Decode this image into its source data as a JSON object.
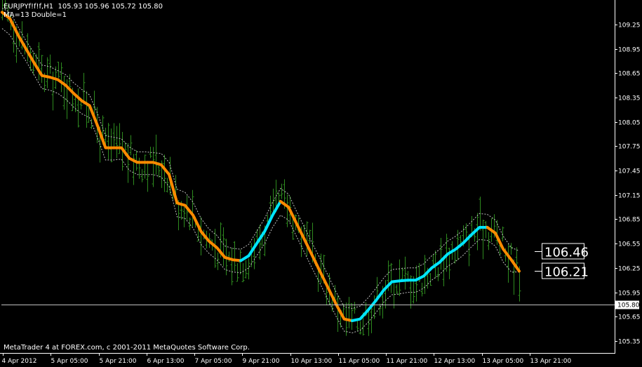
{
  "header": {
    "title": "EURJPYf!f!f,H1  105.93 105.96 105.72 105.80",
    "indicator": "MA=13 Double=1"
  },
  "footer": {
    "text": "MetaTrader 4 at FOREX.com, c 2001-2011 MetaQuotes Software Corp."
  },
  "colors": {
    "background": "#000000",
    "candles": "#2e8b1f",
    "ma_down": "#ff8a00",
    "ma_up": "#00e5ff",
    "envelope": "#bfbfbf",
    "axis": "#ffffff"
  },
  "chart_data": {
    "type": "line",
    "title": "EURJPYf!f!f,H1",
    "y_ticks": [
      109.25,
      108.95,
      108.65,
      108.35,
      108.05,
      107.75,
      107.45,
      107.15,
      106.85,
      106.55,
      106.25,
      105.95,
      105.65,
      105.35
    ],
    "ylim": [
      105.28,
      109.43
    ],
    "x_ticks": [
      "4 Apr 2012",
      "5 Apr 05:00",
      "5 Apr 21:00",
      "6 Apr 13:00",
      "7 Apr 05:00",
      "9 Apr 21:00",
      "10 Apr 13:00",
      "11 Apr 05:00",
      "11 Apr 21:00",
      "12 Apr 13:00",
      "13 Apr 05:00",
      "13 Apr 21:00"
    ],
    "current_price": {
      "label": "105.80",
      "value": 105.8
    },
    "level_labels": [
      {
        "text": "106.46",
        "value": 106.46
      },
      {
        "text": "106.21",
        "value": 106.21
      }
    ],
    "bar_count": 186,
    "ma_series": {
      "name": "MA=13",
      "values": [
        109.4,
        109.32,
        109.12,
        108.95,
        108.78,
        108.62,
        108.6,
        108.57,
        108.5,
        108.4,
        108.31,
        108.25,
        108.0,
        107.73,
        107.73,
        107.73,
        107.6,
        107.55,
        107.55,
        107.55,
        107.52,
        107.4,
        107.05,
        107.02,
        106.9,
        106.7,
        106.58,
        106.5,
        106.38,
        106.35,
        106.34,
        106.4,
        106.55,
        106.7,
        106.9,
        107.07,
        107.0,
        106.8,
        106.6,
        106.4,
        106.2,
        106.0,
        105.8,
        105.62,
        105.6,
        105.62,
        105.73,
        105.85,
        105.98,
        106.08,
        106.09,
        106.1,
        106.1,
        106.15,
        106.25,
        106.32,
        106.42,
        106.48,
        106.56,
        106.66,
        106.75,
        106.75,
        106.68,
        106.48,
        106.35,
        106.21
      ],
      "segments": [
        {
          "direction": "down",
          "from": 0,
          "to": 30
        },
        {
          "direction": "up",
          "from": 30,
          "to": 35
        },
        {
          "direction": "down",
          "from": 35,
          "to": 44
        },
        {
          "direction": "up",
          "from": 44,
          "to": 61
        },
        {
          "direction": "down",
          "from": 61,
          "to": 65
        }
      ]
    },
    "envelope_series": {
      "name": "Double=1",
      "upper": [
        109.45,
        109.4,
        109.22,
        109.05,
        108.9,
        108.75,
        108.73,
        108.68,
        108.63,
        108.53,
        108.45,
        108.38,
        108.15,
        107.88,
        107.86,
        107.84,
        107.74,
        107.68,
        107.68,
        107.67,
        107.66,
        107.55,
        107.22,
        107.18,
        107.06,
        106.86,
        106.73,
        106.65,
        106.52,
        106.49,
        106.48,
        106.54,
        106.7,
        106.86,
        107.06,
        107.23,
        107.16,
        106.95,
        106.75,
        106.55,
        106.36,
        106.15,
        105.95,
        105.77,
        105.75,
        105.78,
        105.88,
        106.0,
        106.13,
        106.23,
        106.24,
        106.25,
        106.25,
        106.3,
        106.4,
        106.48,
        106.58,
        106.64,
        106.72,
        106.82,
        106.92,
        106.91,
        106.84,
        106.64,
        106.5,
        106.46
      ],
      "lower": [
        109.2,
        109.12,
        108.95,
        108.8,
        108.63,
        108.46,
        108.44,
        108.4,
        108.33,
        108.23,
        108.15,
        108.1,
        107.85,
        107.58,
        107.58,
        107.59,
        107.45,
        107.4,
        107.4,
        107.4,
        107.37,
        107.25,
        106.88,
        106.86,
        106.74,
        106.54,
        106.43,
        106.35,
        106.23,
        106.2,
        106.19,
        106.25,
        106.4,
        106.55,
        106.75,
        106.9,
        106.84,
        106.64,
        106.44,
        106.24,
        106.05,
        105.85,
        105.65,
        105.47,
        105.45,
        105.48,
        105.58,
        105.7,
        105.83,
        105.92,
        105.93,
        105.95,
        105.95,
        106.0,
        106.1,
        106.17,
        106.27,
        106.33,
        106.41,
        106.51,
        106.6,
        106.59,
        106.52,
        106.32,
        106.2,
        106.2
      ]
    }
  }
}
